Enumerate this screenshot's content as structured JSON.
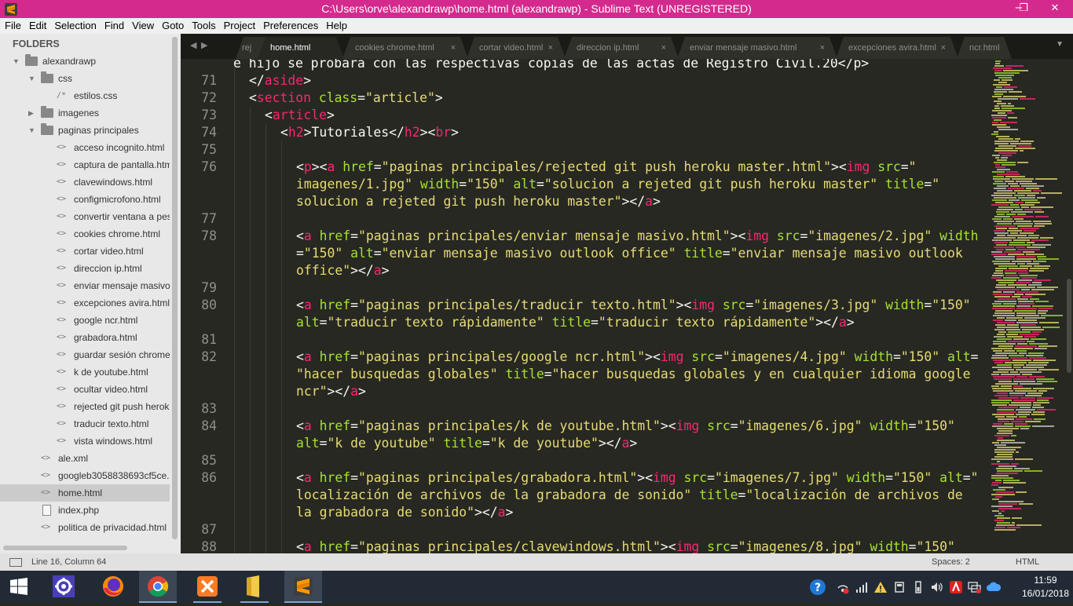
{
  "window": {
    "title": "C:\\Users\\orve\\alexandrawp\\home.html (alexandrawp) - Sublime Text (UNREGISTERED)",
    "minimize": "−",
    "maximize": "❐",
    "close": "✕"
  },
  "menu": [
    "File",
    "Edit",
    "Selection",
    "Find",
    "View",
    "Goto",
    "Tools",
    "Project",
    "Preferences",
    "Help"
  ],
  "sidebar": {
    "header": "FOLDERS",
    "items": [
      {
        "label": "alexandrawp",
        "type": "folder",
        "depth": 0,
        "expanded": true
      },
      {
        "label": "css",
        "type": "folder",
        "depth": 1,
        "expanded": true
      },
      {
        "label": "estilos.css",
        "type": "css",
        "depth": 2
      },
      {
        "label": "imagenes",
        "type": "folder",
        "depth": 1,
        "expanded": false
      },
      {
        "label": "paginas principales",
        "type": "folder",
        "depth": 1,
        "expanded": true
      },
      {
        "label": "acceso incognito.html",
        "type": "html",
        "depth": 2
      },
      {
        "label": "captura de pantalla.html",
        "type": "html",
        "depth": 2
      },
      {
        "label": "clavewindows.html",
        "type": "html",
        "depth": 2
      },
      {
        "label": "configmicrofono.html",
        "type": "html",
        "depth": 2
      },
      {
        "label": "convertir ventana a pestaña",
        "type": "html",
        "depth": 2
      },
      {
        "label": "cookies chrome.html",
        "type": "html",
        "depth": 2
      },
      {
        "label": "cortar video.html",
        "type": "html",
        "depth": 2
      },
      {
        "label": "direccion ip.html",
        "type": "html",
        "depth": 2
      },
      {
        "label": "enviar mensaje masivo.htm",
        "type": "html",
        "depth": 2
      },
      {
        "label": "excepciones avira.html",
        "type": "html",
        "depth": 2
      },
      {
        "label": "google ncr.html",
        "type": "html",
        "depth": 2
      },
      {
        "label": "grabadora.html",
        "type": "html",
        "depth": 2
      },
      {
        "label": "guardar sesión chrome.htm",
        "type": "html",
        "depth": 2
      },
      {
        "label": "k de youtube.html",
        "type": "html",
        "depth": 2
      },
      {
        "label": "ocultar video.html",
        "type": "html",
        "depth": 2
      },
      {
        "label": "rejected git push heroku m",
        "type": "html",
        "depth": 2
      },
      {
        "label": "traducir texto.html",
        "type": "html",
        "depth": 2
      },
      {
        "label": "vista windows.html",
        "type": "html",
        "depth": 2
      },
      {
        "label": "ale.xml",
        "type": "html",
        "depth": 1
      },
      {
        "label": "googleb3058838693cf5ce.htm",
        "type": "html",
        "depth": 1
      },
      {
        "label": "home.html",
        "type": "html",
        "depth": 1,
        "selected": true
      },
      {
        "label": "index.php",
        "type": "page",
        "depth": 1
      },
      {
        "label": "politica de privacidad.html",
        "type": "html",
        "depth": 1
      }
    ]
  },
  "tabs": {
    "items": [
      {
        "label": "rej",
        "active": false
      },
      {
        "label": "home.html",
        "active": true
      },
      {
        "label": "cookies chrome.html",
        "active": false
      },
      {
        "label": "cortar video.html",
        "active": false
      },
      {
        "label": "direccion ip.html",
        "active": false
      },
      {
        "label": "enviar mensaje masivo.html",
        "active": false
      },
      {
        "label": "excepciones avira.html",
        "active": false
      },
      {
        "label": "ncr.html",
        "active": false
      }
    ],
    "close_glyph": "×"
  },
  "editor": {
    "top_partial": "e hijo se probara con las respectivas copias de las actas de Registro Civil.20</p>",
    "lines": [
      {
        "num": "71",
        "segs": [
          [
            "pun",
            "</"
          ],
          [
            "tag",
            "aside"
          ],
          [
            "pun",
            ">"
          ]
        ]
      },
      {
        "num": "72",
        "segs": [
          [
            "pun",
            "<"
          ],
          [
            "tag",
            "section"
          ],
          [
            "pun",
            " "
          ],
          [
            "attr",
            "class"
          ],
          [
            "pun",
            "="
          ],
          [
            "str",
            "\"article\""
          ],
          [
            "pun",
            ">"
          ]
        ]
      },
      {
        "num": "73",
        "segs": [
          [
            "pun",
            "<"
          ],
          [
            "tag",
            "article"
          ],
          [
            "pun",
            ">"
          ]
        ]
      },
      {
        "num": "74",
        "segs": [
          [
            "pun",
            "<"
          ],
          [
            "tag",
            "h2"
          ],
          [
            "pun",
            ">Tutoriales</"
          ],
          [
            "tag",
            "h2"
          ],
          [
            "pun",
            "><"
          ],
          [
            "tag",
            "br"
          ],
          [
            "pun",
            ">"
          ]
        ]
      },
      {
        "num": "75",
        "segs": []
      },
      {
        "num": "76",
        "segs": [
          [
            "pun",
            "<"
          ],
          [
            "tag",
            "p"
          ],
          [
            "pun",
            "><"
          ],
          [
            "tag",
            "a"
          ],
          [
            "pun",
            " "
          ],
          [
            "attr",
            "href"
          ],
          [
            "pun",
            "="
          ],
          [
            "str",
            "\"paginas principales/rejected git push heroku master.html\""
          ],
          [
            "pun",
            "><"
          ],
          [
            "tag",
            "img"
          ],
          [
            "pun",
            " "
          ],
          [
            "attr",
            "src"
          ],
          [
            "pun",
            "="
          ],
          [
            "str",
            "\""
          ]
        ]
      },
      {
        "num": "",
        "segs": [
          [
            "str",
            "imagenes/1.jpg\""
          ],
          [
            "pun",
            " "
          ],
          [
            "attr",
            "width"
          ],
          [
            "pun",
            "="
          ],
          [
            "str",
            "\"150\""
          ],
          [
            "pun",
            " "
          ],
          [
            "attr",
            "alt"
          ],
          [
            "pun",
            "="
          ],
          [
            "str",
            "\"solucion a rejeted git push heroku master\""
          ],
          [
            "pun",
            " "
          ],
          [
            "attr",
            "title"
          ],
          [
            "pun",
            "="
          ],
          [
            "str",
            "\""
          ]
        ]
      },
      {
        "num": "",
        "segs": [
          [
            "str",
            "solucion a rejeted git push heroku master\""
          ],
          [
            "pun",
            "></"
          ],
          [
            "tag",
            "a"
          ],
          [
            "pun",
            ">"
          ]
        ]
      },
      {
        "num": "77",
        "segs": []
      },
      {
        "num": "78",
        "segs": [
          [
            "pun",
            "<"
          ],
          [
            "tag",
            "a"
          ],
          [
            "pun",
            " "
          ],
          [
            "attr",
            "href"
          ],
          [
            "pun",
            "="
          ],
          [
            "str",
            "\"paginas principales/enviar mensaje masivo.html\""
          ],
          [
            "pun",
            "><"
          ],
          [
            "tag",
            "img"
          ],
          [
            "pun",
            " "
          ],
          [
            "attr",
            "src"
          ],
          [
            "pun",
            "="
          ],
          [
            "str",
            "\"imagenes/2.jpg\""
          ],
          [
            "pun",
            " "
          ],
          [
            "attr",
            "width"
          ]
        ]
      },
      {
        "num": "",
        "segs": [
          [
            "pun",
            "="
          ],
          [
            "str",
            "\"150\""
          ],
          [
            "pun",
            " "
          ],
          [
            "attr",
            "alt"
          ],
          [
            "pun",
            "="
          ],
          [
            "str",
            "\"enviar mensaje masivo outlook office\""
          ],
          [
            "pun",
            " "
          ],
          [
            "attr",
            "title"
          ],
          [
            "pun",
            "="
          ],
          [
            "str",
            "\"enviar mensaje masivo outlook"
          ]
        ]
      },
      {
        "num": "",
        "segs": [
          [
            "str",
            "office\""
          ],
          [
            "pun",
            "></"
          ],
          [
            "tag",
            "a"
          ],
          [
            "pun",
            ">"
          ]
        ]
      },
      {
        "num": "79",
        "segs": []
      },
      {
        "num": "80",
        "segs": [
          [
            "pun",
            "<"
          ],
          [
            "tag",
            "a"
          ],
          [
            "pun",
            " "
          ],
          [
            "attr",
            "href"
          ],
          [
            "pun",
            "="
          ],
          [
            "str",
            "\"paginas principales/traducir texto.html\""
          ],
          [
            "pun",
            "><"
          ],
          [
            "tag",
            "img"
          ],
          [
            "pun",
            " "
          ],
          [
            "attr",
            "src"
          ],
          [
            "pun",
            "="
          ],
          [
            "str",
            "\"imagenes/3.jpg\""
          ],
          [
            "pun",
            " "
          ],
          [
            "attr",
            "width"
          ],
          [
            "pun",
            "="
          ],
          [
            "str",
            "\"150\""
          ]
        ]
      },
      {
        "num": "",
        "segs": [
          [
            "attr",
            "alt"
          ],
          [
            "pun",
            "="
          ],
          [
            "str",
            "\"traducir texto rápidamente\""
          ],
          [
            "pun",
            " "
          ],
          [
            "attr",
            "title"
          ],
          [
            "pun",
            "="
          ],
          [
            "str",
            "\"traducir texto rápidamente\""
          ],
          [
            "pun",
            "></"
          ],
          [
            "tag",
            "a"
          ],
          [
            "pun",
            ">"
          ]
        ]
      },
      {
        "num": "81",
        "segs": []
      },
      {
        "num": "82",
        "segs": [
          [
            "pun",
            "<"
          ],
          [
            "tag",
            "a"
          ],
          [
            "pun",
            " "
          ],
          [
            "attr",
            "href"
          ],
          [
            "pun",
            "="
          ],
          [
            "str",
            "\"paginas principales/google ncr.html\""
          ],
          [
            "pun",
            "><"
          ],
          [
            "tag",
            "img"
          ],
          [
            "pun",
            " "
          ],
          [
            "attr",
            "src"
          ],
          [
            "pun",
            "="
          ],
          [
            "str",
            "\"imagenes/4.jpg\""
          ],
          [
            "pun",
            " "
          ],
          [
            "attr",
            "width"
          ],
          [
            "pun",
            "="
          ],
          [
            "str",
            "\"150\""
          ],
          [
            "pun",
            " "
          ],
          [
            "attr",
            "alt"
          ],
          [
            "pun",
            "="
          ]
        ]
      },
      {
        "num": "",
        "segs": [
          [
            "str",
            "\"hacer busquedas globales\""
          ],
          [
            "pun",
            " "
          ],
          [
            "attr",
            "title"
          ],
          [
            "pun",
            "="
          ],
          [
            "str",
            "\"hacer busquedas globales y en cualquier idioma google"
          ]
        ]
      },
      {
        "num": "",
        "segs": [
          [
            "str",
            "ncr\""
          ],
          [
            "pun",
            "></"
          ],
          [
            "tag",
            "a"
          ],
          [
            "pun",
            ">"
          ]
        ]
      },
      {
        "num": "83",
        "segs": []
      },
      {
        "num": "84",
        "segs": [
          [
            "pun",
            "<"
          ],
          [
            "tag",
            "a"
          ],
          [
            "pun",
            " "
          ],
          [
            "attr",
            "href"
          ],
          [
            "pun",
            "="
          ],
          [
            "str",
            "\"paginas principales/k de youtube.html\""
          ],
          [
            "pun",
            "><"
          ],
          [
            "tag",
            "img"
          ],
          [
            "pun",
            " "
          ],
          [
            "attr",
            "src"
          ],
          [
            "pun",
            "="
          ],
          [
            "str",
            "\"imagenes/6.jpg\""
          ],
          [
            "pun",
            " "
          ],
          [
            "attr",
            "width"
          ],
          [
            "pun",
            "="
          ],
          [
            "str",
            "\"150\""
          ]
        ]
      },
      {
        "num": "",
        "segs": [
          [
            "attr",
            "alt"
          ],
          [
            "pun",
            "="
          ],
          [
            "str",
            "\"k de youtube\""
          ],
          [
            "pun",
            " "
          ],
          [
            "attr",
            "title"
          ],
          [
            "pun",
            "="
          ],
          [
            "str",
            "\"k de youtube\""
          ],
          [
            "pun",
            "></"
          ],
          [
            "tag",
            "a"
          ],
          [
            "pun",
            ">"
          ]
        ]
      },
      {
        "num": "85",
        "segs": []
      },
      {
        "num": "86",
        "segs": [
          [
            "pun",
            "<"
          ],
          [
            "tag",
            "a"
          ],
          [
            "pun",
            " "
          ],
          [
            "attr",
            "href"
          ],
          [
            "pun",
            "="
          ],
          [
            "str",
            "\"paginas principales/grabadora.html\""
          ],
          [
            "pun",
            "><"
          ],
          [
            "tag",
            "img"
          ],
          [
            "pun",
            " "
          ],
          [
            "attr",
            "src"
          ],
          [
            "pun",
            "="
          ],
          [
            "str",
            "\"imagenes/7.jpg\""
          ],
          [
            "pun",
            " "
          ],
          [
            "attr",
            "width"
          ],
          [
            "pun",
            "="
          ],
          [
            "str",
            "\"150\""
          ],
          [
            "pun",
            " "
          ],
          [
            "attr",
            "alt"
          ],
          [
            "pun",
            "="
          ],
          [
            "str",
            "\""
          ]
        ]
      },
      {
        "num": "",
        "segs": [
          [
            "str",
            "localización de archivos de la grabadora de sonido\""
          ],
          [
            "pun",
            " "
          ],
          [
            "attr",
            "title"
          ],
          [
            "pun",
            "="
          ],
          [
            "str",
            "\"localización de archivos de"
          ]
        ]
      },
      {
        "num": "",
        "segs": [
          [
            "str",
            "la grabadora de sonido\""
          ],
          [
            "pun",
            "></"
          ],
          [
            "tag",
            "a"
          ],
          [
            "pun",
            ">"
          ]
        ]
      },
      {
        "num": "87",
        "segs": []
      },
      {
        "num": "88",
        "segs": [
          [
            "pun",
            "<"
          ],
          [
            "tag",
            "a"
          ],
          [
            "pun",
            " "
          ],
          [
            "attr",
            "href"
          ],
          [
            "pun",
            "="
          ],
          [
            "str",
            "\"paginas principales/clavewindows.html\""
          ],
          [
            "pun",
            "><"
          ],
          [
            "tag",
            "img"
          ],
          [
            "pun",
            " "
          ],
          [
            "attr",
            "src"
          ],
          [
            "pun",
            "="
          ],
          [
            "str",
            "\"imagenes/8.jpg\""
          ],
          [
            "pun",
            " "
          ],
          [
            "attr",
            "width"
          ],
          [
            "pun",
            "="
          ],
          [
            "str",
            "\"150\""
          ]
        ]
      }
    ]
  },
  "status": {
    "position": "Line 16, Column 64",
    "spaces": "Spaces: 2",
    "syntax": "HTML"
  },
  "taskbar": {
    "apps": [
      "start-button",
      "settings-app",
      "firefox-app",
      "chrome-app",
      "xampp-app",
      "file-explorer-app",
      "sublime-text-app"
    ],
    "time": "11:59",
    "date": "16/01/2018"
  },
  "colors": {
    "titlebar": "#d42a8e",
    "editor_bg": "#272822",
    "tag": "#f92672",
    "attr": "#a6e22e",
    "string": "#e6db74"
  }
}
